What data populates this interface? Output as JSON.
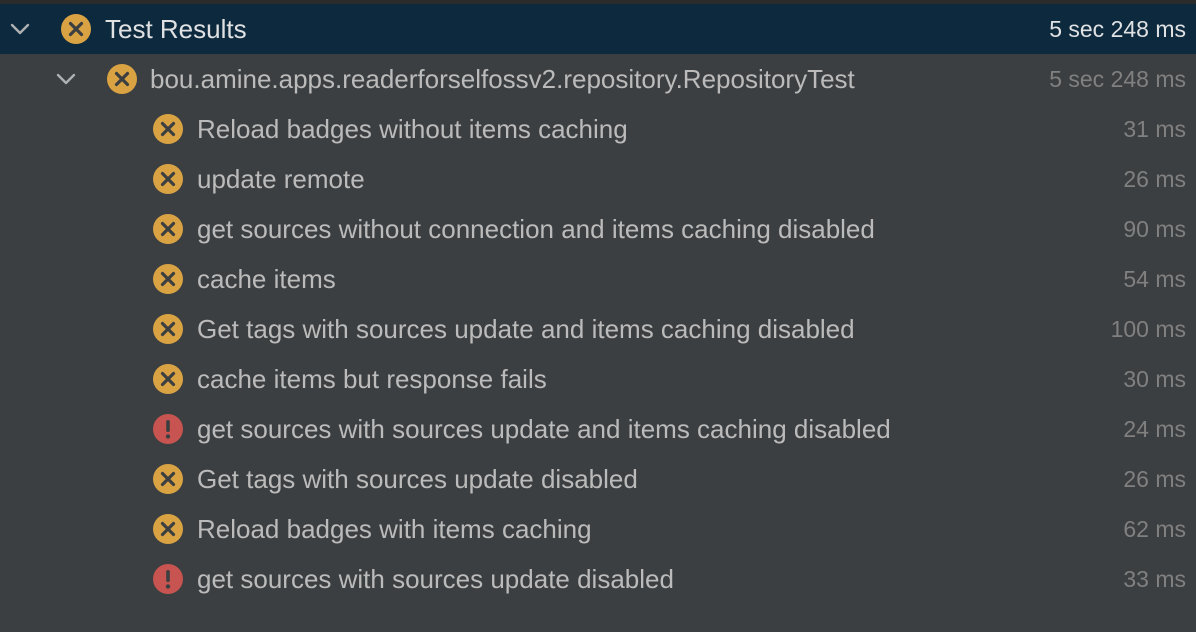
{
  "root": {
    "label": "Test Results",
    "duration": "5 sec 248 ms",
    "status": "failed",
    "chevron_icon": "chevron-down-icon"
  },
  "suite": {
    "label": "bou.amine.apps.readerforselfossv2.repository.RepositoryTest",
    "duration": "5 sec 248 ms",
    "status": "failed",
    "chevron_icon": "chevron-down-icon"
  },
  "tests": [
    {
      "label": "Reload badges without items caching",
      "duration": "31 ms",
      "status": "failed"
    },
    {
      "label": "update remote",
      "duration": "26 ms",
      "status": "failed"
    },
    {
      "label": "get sources without connection and items caching disabled",
      "duration": "90 ms",
      "status": "failed"
    },
    {
      "label": "cache items",
      "duration": "54 ms",
      "status": "failed"
    },
    {
      "label": "Get tags with sources update and items caching disabled",
      "duration": "100 ms",
      "status": "failed"
    },
    {
      "label": "cache items but response fails",
      "duration": "30 ms",
      "status": "failed"
    },
    {
      "label": "get sources with sources update and items caching disabled",
      "duration": "24 ms",
      "status": "error"
    },
    {
      "label": "Get tags with sources update disabled",
      "duration": "26 ms",
      "status": "failed"
    },
    {
      "label": "Reload badges with items caching",
      "duration": "62 ms",
      "status": "failed"
    },
    {
      "label": "get sources with sources update disabled",
      "duration": "33 ms",
      "status": "error"
    }
  ],
  "colors": {
    "failed": "#d9a343",
    "error": "#c75450",
    "selected_row": "#0d293e",
    "background": "#3c3f41"
  }
}
